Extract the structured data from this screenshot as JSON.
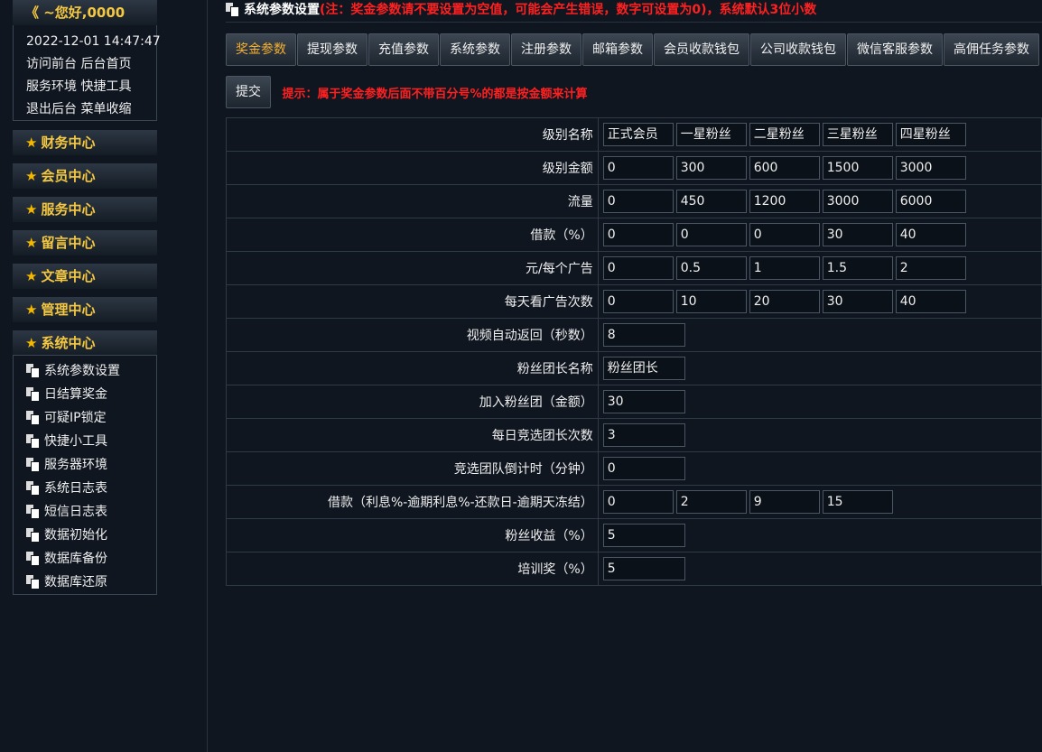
{
  "sidebar": {
    "greeting": "《 ~您好,0000",
    "datetime": "2022-12-01 14:47:47",
    "links": [
      [
        "访问前台",
        "后台首页"
      ],
      [
        "服务环境",
        "快捷工具"
      ],
      [
        "退出后台",
        "菜单收缩"
      ]
    ],
    "menus": [
      "财务中心",
      "会员中心",
      "服务中心",
      "留言中心",
      "文章中心",
      "管理中心",
      "系统中心"
    ],
    "system_items": [
      "系统参数设置",
      "日结算奖金",
      "可疑IP锁定",
      "快捷小工具",
      "服务器环境",
      "系统日志表",
      "短信日志表",
      "数据初始化",
      "数据库备份",
      "数据库还原"
    ]
  },
  "header": {
    "title": "系统参数设置",
    "note": "(注：奖金参数请不要设置为空值，可能会产生错误，数字可设置为0)，系统默认3位小数"
  },
  "tabs": [
    "奖金参数",
    "提现参数",
    "充值参数",
    "系统参数",
    "注册参数",
    "邮箱参数",
    "会员收款钱包",
    "公司收款钱包",
    "微信客服参数",
    "高佣任务参数"
  ],
  "active_tab": 0,
  "submit_label": "提交",
  "hint": "提示：属于奖金参数后面不带百分号%的都是按金额来计算",
  "rows": [
    {
      "label": "级别名称",
      "values": [
        "正式会员",
        "一星粉丝",
        "二星粉丝",
        "三星粉丝",
        "四星粉丝"
      ]
    },
    {
      "label": "级别金额",
      "values": [
        "0",
        "300",
        "600",
        "1500",
        "3000"
      ]
    },
    {
      "label": "流量",
      "values": [
        "0",
        "450",
        "1200",
        "3000",
        "6000"
      ]
    },
    {
      "label": "借款（%）",
      "values": [
        "0",
        "0",
        "0",
        "30",
        "40"
      ]
    },
    {
      "label": "元/每个广告",
      "values": [
        "0",
        "0.5",
        "1",
        "1.5",
        "2"
      ]
    },
    {
      "label": "每天看广告次数",
      "values": [
        "0",
        "10",
        "20",
        "30",
        "40"
      ]
    },
    {
      "label": "视频自动返回（秒数）",
      "values": [
        "8"
      ]
    },
    {
      "label": "粉丝团长名称",
      "values": [
        "粉丝团长"
      ]
    },
    {
      "label": "加入粉丝团（金额）",
      "values": [
        "30"
      ]
    },
    {
      "label": "每日竞选团长次数",
      "values": [
        "3"
      ]
    },
    {
      "label": "竞选团队倒计时（分钟）",
      "values": [
        "0"
      ]
    },
    {
      "label": "借款（利息%-逾期利息%-还款日-逾期天冻结）",
      "values": [
        "0",
        "2",
        "9",
        "15"
      ]
    },
    {
      "label": "粉丝收益（%）",
      "values": [
        "5"
      ]
    },
    {
      "label": "培训奖（%）",
      "values": [
        "5"
      ]
    }
  ]
}
